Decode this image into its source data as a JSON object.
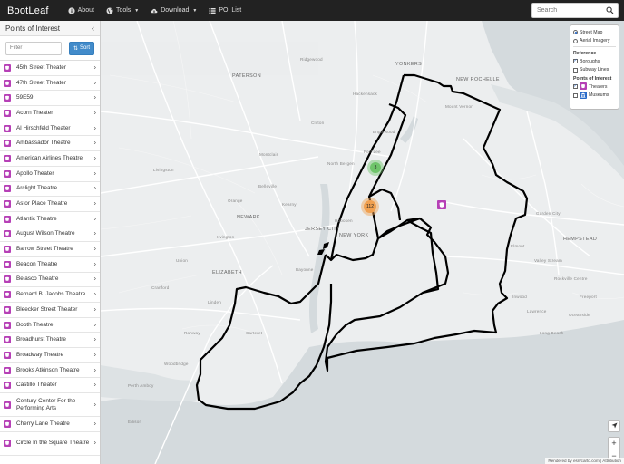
{
  "navbar": {
    "brand": "BootLeaf",
    "items": [
      {
        "label": "About",
        "icon": "info-icon"
      },
      {
        "label": "Tools",
        "icon": "globe-icon",
        "dropdown": true
      },
      {
        "label": "Download",
        "icon": "cloud-download-icon",
        "dropdown": true
      },
      {
        "label": "POI List",
        "icon": "list-icon"
      }
    ],
    "search_placeholder": "Search"
  },
  "sidebar": {
    "title": "Points of Interest",
    "filter_placeholder": "Filter",
    "sort_label": "Sort",
    "items": [
      "45th Street Theater",
      "47th Street Theater",
      "59E59",
      "Acorn Theater",
      "Al Hirschfeld Theater",
      "Ambassador Theatre",
      "American Airlines Theatre",
      "Apollo Theater",
      "Arclight Theatre",
      "Astor Place Theatre",
      "Atlantic Theatre",
      "August Wilson Theatre",
      "Barrow Street Theatre",
      "Beacon Theatre",
      "Belasco Theatre",
      "Bernard B. Jacobs Theatre",
      "Bleecker Street Theater",
      "Booth Theatre",
      "Broadhurst Theatre",
      "Broadway Theatre",
      "Brooks Atkinson Theatre",
      "Castillo Theater",
      "Century Center For the Performing Arts",
      "Cherry Lane Theatre",
      "Circle In the Square Theatre"
    ]
  },
  "layers": {
    "basemaps": [
      {
        "label": "Street Map",
        "selected": true
      },
      {
        "label": "Aerial Imagery",
        "selected": false
      }
    ],
    "reference_title": "Reference",
    "reference": [
      {
        "label": "Boroughs",
        "checked": true
      },
      {
        "label": "Subway Lines",
        "checked": false
      }
    ],
    "poi_title": "Points of Interest",
    "poi": [
      {
        "label": "Theaters",
        "checked": true,
        "icon": "theater-icon"
      },
      {
        "label": "Museums",
        "checked": false,
        "icon": "museum-icon"
      }
    ]
  },
  "map": {
    "clusters": [
      {
        "count": "3",
        "color": "#6fc46a"
      },
      {
        "count": "112",
        "color": "#f0a050"
      }
    ],
    "places": [
      "YONKERS",
      "NEW ROCHELLE",
      "PATERSON",
      "NEWARK",
      "JERSEY CITY",
      "NEW YORK",
      "ELIZABETH",
      "HEMPSTEAD",
      "Clifton",
      "North Bergen",
      "Livingston",
      "Union",
      "Linden",
      "Rahway",
      "Carteret",
      "Hackensack",
      "Long Beach",
      "Garden City",
      "Mount Vernon",
      "Hoboken",
      "Bayonne",
      "Kearny",
      "Belleville",
      "Valley Stream",
      "Rockville Centre",
      "Freeport",
      "Fort Lee",
      "Englewood",
      "Ridgewood",
      "Montclair",
      "Orange",
      "Irvington",
      "Cranford",
      "Woodbridge",
      "Perth Amboy",
      "Elmont",
      "Oceanside",
      "Inwood",
      "Lawrence",
      "Edison"
    ],
    "attribution": "Rendered by esri/carto.com | Attribution"
  },
  "colors": {
    "navbar": "#222222",
    "accent": "#428bca",
    "theater_marker": "#b640b6",
    "borough_line": "#000000"
  }
}
